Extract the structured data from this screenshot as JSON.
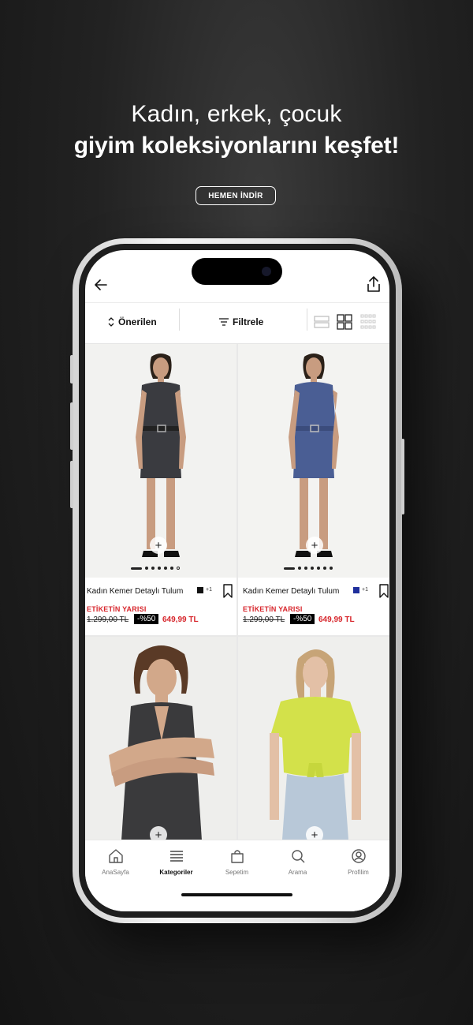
{
  "headline": {
    "line1": "Kadın, erkek, çocuk",
    "line2": "giyim koleksiyonlarını keşfet!"
  },
  "cta": {
    "label": "HEMEN İNDİR"
  },
  "app": {
    "toolbar": {
      "sort_label": "Önerilen",
      "filter_label": "Filtrele"
    },
    "products": [
      {
        "name": "Kadın Kemer Detaylı Tulum",
        "swatch_color": "#111111",
        "extra_colors": "+1",
        "promo": "ETİKETİN YARISI",
        "old_price": "1.299,00 TL",
        "discount": "-%50",
        "new_price": "649,99 TL"
      },
      {
        "name": "Kadın Kemer Detaylı Tulum",
        "swatch_color": "#1f2f9c",
        "extra_colors": "+1",
        "promo": "ETİKETİN YARISI",
        "old_price": "1.299,00 TL",
        "discount": "-%50",
        "new_price": "649,99 TL"
      }
    ],
    "bottom_nav": [
      {
        "label": "AnaSayfa",
        "icon": "home-icon"
      },
      {
        "label": "Kategoriler",
        "icon": "list-icon",
        "active": true
      },
      {
        "label": "Sepetim",
        "icon": "bag-icon"
      },
      {
        "label": "Arama",
        "icon": "search-icon"
      },
      {
        "label": "Profilim",
        "icon": "user-icon"
      }
    ]
  },
  "colors": {
    "accent_red": "#d7262c",
    "discount_bg": "#000000"
  }
}
